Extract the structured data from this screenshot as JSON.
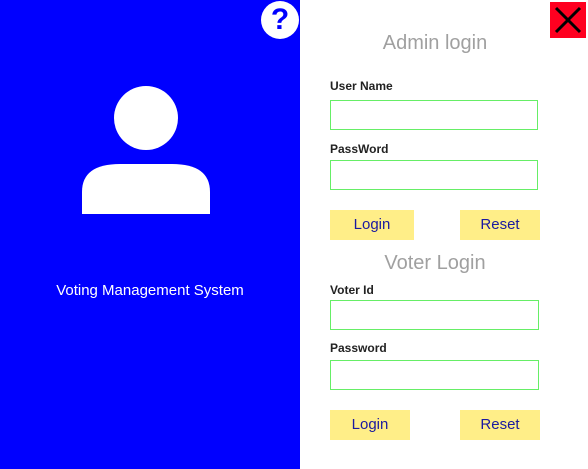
{
  "left_panel": {
    "help_label": "?",
    "system_title": "Voting Management System"
  },
  "window": {
    "close_icon": "close-icon"
  },
  "admin": {
    "title": "Admin login",
    "username_label": "User Name",
    "username_value": "",
    "password_label": "PassWord",
    "password_value": "",
    "login_label": "Login",
    "reset_label": "Reset"
  },
  "voter": {
    "title": "Voter Login",
    "voterid_label": "Voter Id",
    "voterid_value": "",
    "password_label": "Password",
    "password_value": "",
    "login_label": "Login",
    "reset_label": "Reset"
  },
  "colors": {
    "left_panel_bg": "#0000ff",
    "button_bg": "#ffee88",
    "button_text": "#1a1aa0",
    "input_border": "#66ee66",
    "close_bg": "#ff0020"
  }
}
